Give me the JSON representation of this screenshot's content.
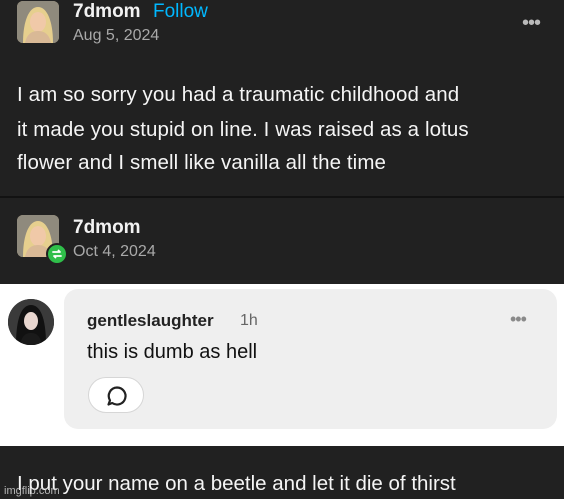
{
  "post": {
    "author": "7dmom",
    "follow_label": "Follow",
    "date": "Aug 5, 2024",
    "more_icon": "•••",
    "body_lines": [
      "I am so sorry you had a traumatic childhood and",
      "it made you stupid on line. I was raised as a lotus",
      "flower and I smell like vanilla all the time"
    ]
  },
  "reblog": {
    "author": "7dmom",
    "date": "Oct 4, 2024",
    "badge_icon": "reblog-icon",
    "badge_color": "#2fbf4a"
  },
  "comment": {
    "username": "gentleslaughter",
    "time": "1h",
    "text": "this is dumb as hell",
    "reply_icon": "speech-bubble-icon",
    "more_icon": "•••"
  },
  "bottom": {
    "text": "I put your name on a beetle and let it die of thirst",
    "watermark": "imgflip.com"
  },
  "colors": {
    "follow": "#00b8ff",
    "dark_bg": "#212121",
    "bubble_bg": "#efefef"
  }
}
